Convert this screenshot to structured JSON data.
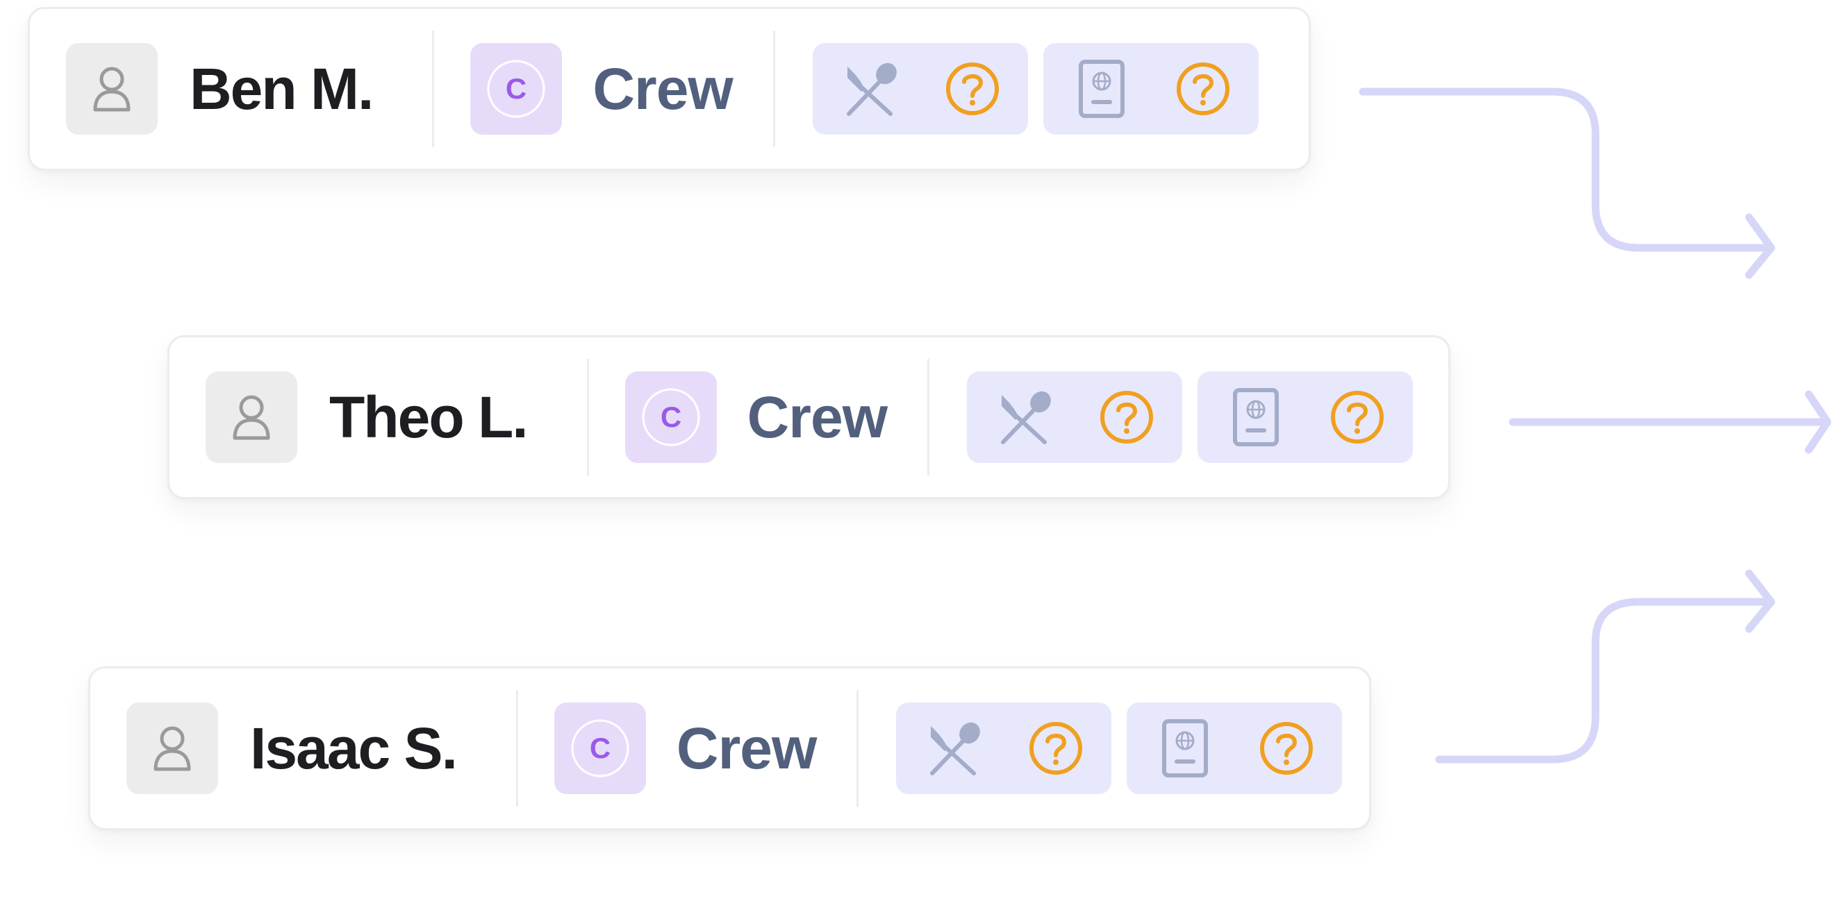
{
  "colors": {
    "name_text": "#1e1e22",
    "role_text": "#52607e",
    "role_badge_bg": "#e6dcfa",
    "role_badge_letter": "#9b59e8",
    "pill_bg": "#e8e8fc",
    "pill_icon": "#a3acc8",
    "unknown_status": "#f0a020",
    "connector": "#d6d6f8"
  },
  "icons": {
    "avatar": "user-outline-icon",
    "role": "circle-c-icon",
    "meal": "fork-knife-icon",
    "passport": "passport-icon",
    "status": "question-circle-icon"
  },
  "people": [
    {
      "name": "Ben M.",
      "role_letter": "C",
      "role": "Crew",
      "meal_status": "unknown",
      "passport_status": "unknown"
    },
    {
      "name": "Theo L.",
      "role_letter": "C",
      "role": "Crew",
      "meal_status": "unknown",
      "passport_status": "unknown"
    },
    {
      "name": "Isaac S.",
      "role_letter": "C",
      "role": "Crew",
      "meal_status": "unknown",
      "passport_status": "unknown"
    }
  ]
}
